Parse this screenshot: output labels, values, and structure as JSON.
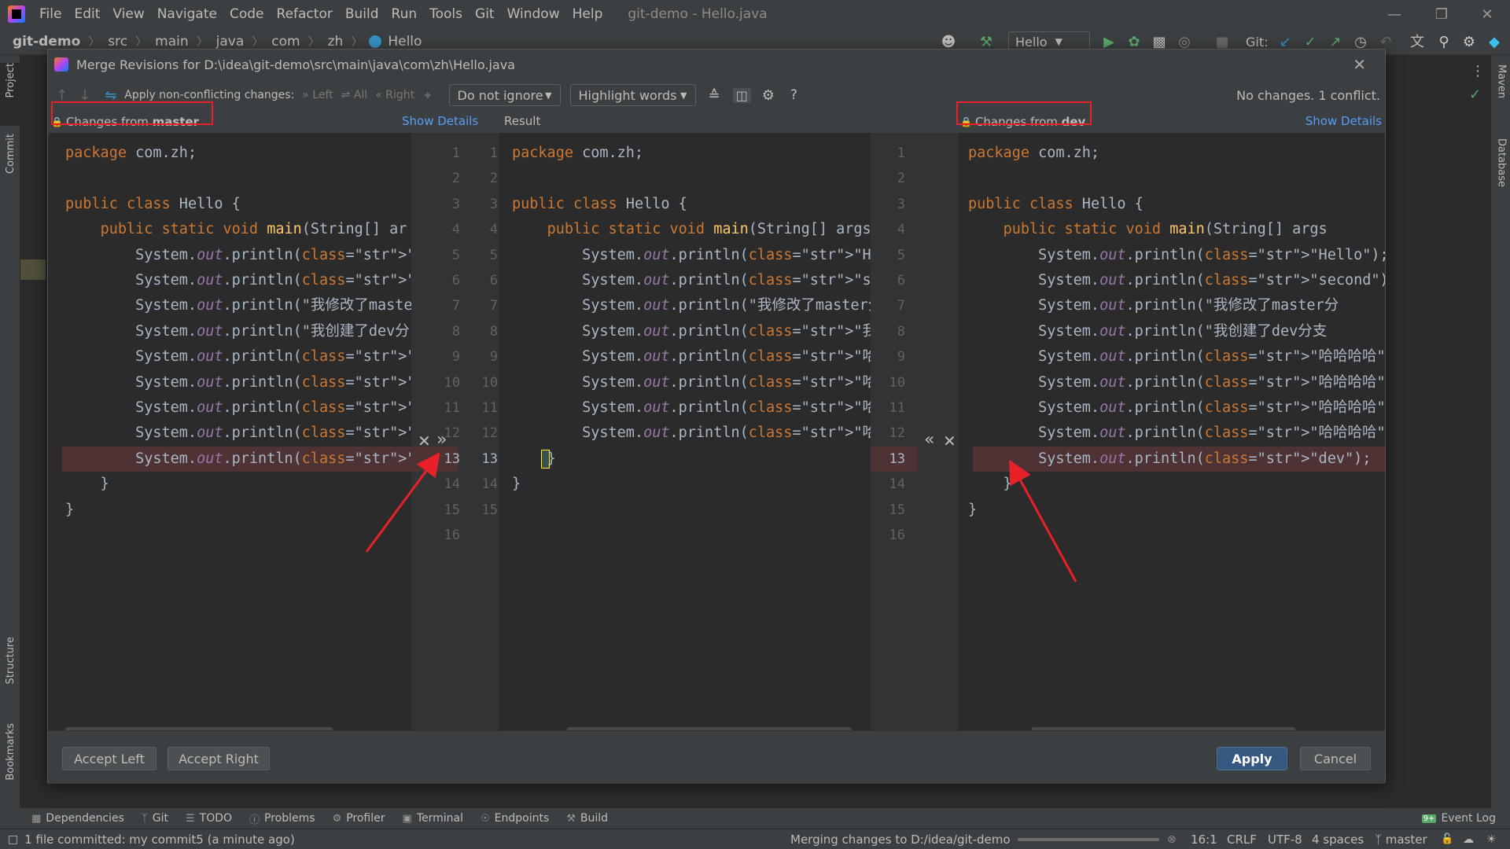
{
  "menu": [
    "File",
    "Edit",
    "View",
    "Navigate",
    "Code",
    "Refactor",
    "Build",
    "Run",
    "Tools",
    "Git",
    "Window",
    "Help"
  ],
  "window_title": "git-demo - Hello.java",
  "breadcrumb": [
    "git-demo",
    "src",
    "main",
    "java",
    "com",
    "zh",
    "Hello"
  ],
  "run_config": "Hello",
  "git_label": "Git:",
  "left_tabs": [
    "Project",
    "Commit",
    "Structure",
    "Bookmarks"
  ],
  "right_tabs": [
    "Maven",
    "Database"
  ],
  "dialog": {
    "title": "Merge Revisions for D:\\idea\\git-demo\\src\\main\\java\\com\\zh\\Hello.java",
    "apply_non_conflicting": "Apply non-conflicting changes:",
    "left_btn": "Left",
    "all_btn": "All",
    "right_btn": "Right",
    "ignore_combo": "Do not ignore",
    "highlight_combo": "Highlight words",
    "help": "?",
    "status": "No changes. 1 conflict.",
    "left_header_prefix": "Changes from ",
    "left_header_branch": "master",
    "show_details": "Show Details",
    "result_header": "Result",
    "right_header_prefix": "Changes from ",
    "right_header_branch": "dev",
    "accept_left": "Accept Left",
    "accept_right": "Accept Right",
    "apply": "Apply",
    "cancel": "Cancel"
  },
  "code": {
    "left": [
      "package com.zh;",
      "",
      "public class Hello {",
      "    public static void main(String[] ar",
      "        System.out.println(\"Hello\");",
      "        System.out.println(\"second\");",
      "        System.out.println(\"我修改了maste",
      "        System.out.println(\"我创建了dev分",
      "        System.out.println(\"哈哈哈哈\");",
      "        System.out.println(\"哈哈哈哈\");",
      "        System.out.println(\"哈哈哈哈\");",
      "        System.out.println(\"哈哈哈哈\");",
      "        System.out.println(\"master\");",
      "    }",
      "}"
    ],
    "left_nums": [
      "1",
      "2",
      "3",
      "4",
      "5",
      "6",
      "7",
      "8",
      "9",
      "10",
      "11",
      "12",
      "13",
      "14",
      "15",
      "16"
    ],
    "result": [
      "package com.zh;",
      "",
      "public class Hello {",
      "    public static void main(String[] args)",
      "        System.out.println(\"Hello\");",
      "        System.out.println(\"second\");",
      "        System.out.println(\"我修改了master分",
      "        System.out.println(\"我创建了dev分支\")",
      "        System.out.println(\"哈哈哈哈\");",
      "        System.out.println(\"哈哈哈哈\");",
      "        System.out.println(\"哈哈哈哈\");",
      "        System.out.println(\"哈哈哈哈\");",
      "    }",
      "}"
    ],
    "result_nums": [
      "1",
      "2",
      "3",
      "4",
      "5",
      "6",
      "7",
      "8",
      "9",
      "10",
      "11",
      "12",
      "13",
      "14",
      "15"
    ],
    "right": [
      "package com.zh;",
      "",
      "public class Hello {",
      "    public static void main(String[] args",
      "        System.out.println(\"Hello\");",
      "        System.out.println(\"second\");",
      "        System.out.println(\"我修改了master分",
      "        System.out.println(\"我创建了dev分支",
      "        System.out.println(\"哈哈哈哈\");",
      "        System.out.println(\"哈哈哈哈\");",
      "        System.out.println(\"哈哈哈哈\");",
      "        System.out.println(\"哈哈哈哈\");",
      "        System.out.println(\"dev\");",
      "    }",
      "}"
    ],
    "right_nums": [
      "1",
      "2",
      "3",
      "4",
      "5",
      "6",
      "7",
      "8",
      "9",
      "10",
      "11",
      "12",
      "13",
      "14",
      "15",
      "16"
    ]
  },
  "bottom_tabs": [
    "Dependencies",
    "Git",
    "TODO",
    "Problems",
    "Profiler",
    "Terminal",
    "Endpoints",
    "Build"
  ],
  "event_log": "Event Log",
  "event_badge": "9+",
  "status": {
    "left": "1 file committed: my commit5 (a minute ago)",
    "merging": "Merging changes to D:/idea/git-demo",
    "position": "16:1",
    "line_sep": "CRLF",
    "encoding": "UTF-8",
    "indent": "4 spaces",
    "branch": "master"
  }
}
